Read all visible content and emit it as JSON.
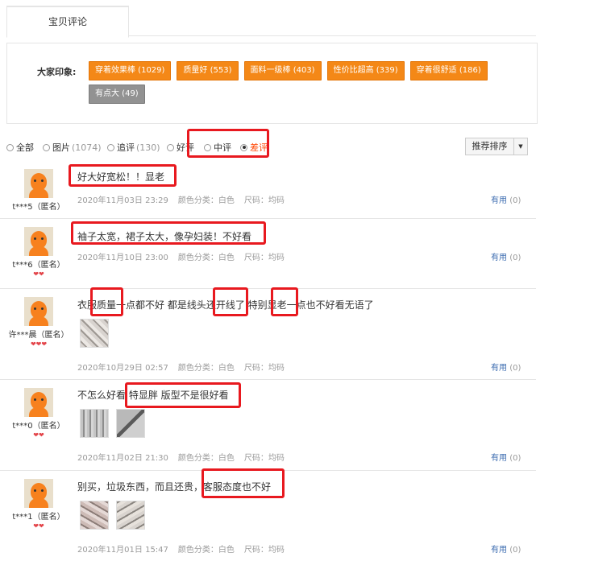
{
  "tab": {
    "label": "宝贝评论"
  },
  "impressions": {
    "label": "大家印象:",
    "tags": [
      {
        "text": "穿着效果棒 (1029)",
        "color": "#f48817"
      },
      {
        "text": "质量好 (553)",
        "color": "#f48817"
      },
      {
        "text": "面料一级棒 (403)",
        "color": "#f48817"
      },
      {
        "text": "性价比超高 (339)",
        "color": "#f48817"
      },
      {
        "text": "穿着很舒适 (186)",
        "color": "#f48817"
      },
      {
        "text": "有点大 (49)",
        "color": "#929292"
      }
    ]
  },
  "filters": [
    {
      "label": "全部",
      "count": "",
      "selected": false
    },
    {
      "label": "图片",
      "count": "(1074)",
      "selected": false
    },
    {
      "label": "追评",
      "count": "(130)",
      "selected": false
    },
    {
      "label": "好评",
      "count": "",
      "selected": false
    },
    {
      "label": "中评",
      "count": "",
      "selected": false
    },
    {
      "label": "差评",
      "count": "",
      "selected": true
    }
  ],
  "sort": {
    "label": "推荐排序",
    "icon": "caret-down-icon"
  },
  "reviews": [
    {
      "user": "t***5（匿名）",
      "hearts": "",
      "text": "好大好宽松！！显老",
      "date": "2020年11月03日 23:29",
      "color": "颜色分类：白色",
      "size": "尺码：均码",
      "useful": "有用",
      "useful_count": "(0)"
    },
    {
      "user": "t***6（匿名）",
      "hearts": "❤❤",
      "text": "袖子太宽，裙子太大，像孕妇装！不好看",
      "date": "2020年11月10日 23:00",
      "color": "颜色分类：白色",
      "size": "尺码：均码",
      "useful": "有用",
      "useful_count": "(0)"
    },
    {
      "user": "许***晨（匿名）",
      "hearts": "❤❤❤",
      "text": "衣服质量一点都不好 都是线头还开线了 特别显老一点也不好看无语了",
      "date": "2020年10月29日 02:57",
      "color": "颜色分类：白色",
      "size": "尺码：均码",
      "useful": "有用",
      "useful_count": "(0)"
    },
    {
      "user": "t***0（匿名）",
      "hearts": "❤❤",
      "text": "不怎么好看 特显胖 版型不是很好看",
      "date": "2020年11月02日 21:30",
      "color": "颜色分类：白色",
      "size": "尺码：均码",
      "useful": "有用",
      "useful_count": "(0)"
    },
    {
      "user": "t***1（匿名）",
      "hearts": "❤❤",
      "text": "别买，垃圾东西，而且还贵，客服态度也不好",
      "date": "2020年11月01日 15:47",
      "color": "颜色分类：白色",
      "size": "尺码：均码",
      "useful": "有用",
      "useful_count": "(0)"
    }
  ]
}
